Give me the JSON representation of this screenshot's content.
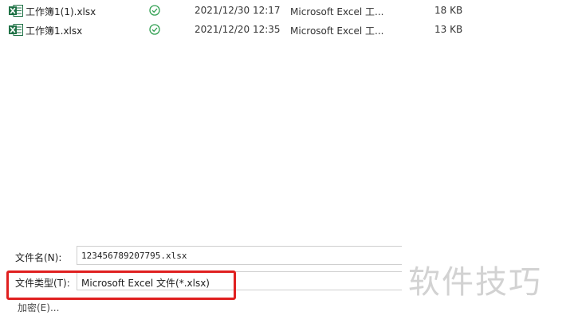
{
  "files": [
    {
      "name": "工作簿1(1).xlsx",
      "date": "2021/12/30 12:17",
      "type": "Microsoft Excel 工...",
      "size": "18 KB",
      "status_icon": "synced-check-icon"
    },
    {
      "name": "工作簿1.xlsx",
      "date": "2021/12/20 12:35",
      "type": "Microsoft Excel 工...",
      "size": "13 KB",
      "status_icon": "synced-check-icon"
    }
  ],
  "form": {
    "filename_label": "文件名(N):",
    "filename_value": "123456789207795.xlsx",
    "filetype_label": "文件类型(T):",
    "filetype_value": "Microsoft Excel 文件(*.xlsx)",
    "encrypt_link": "加密(E)..."
  },
  "watermark": "软件技巧",
  "colors": {
    "highlight": "#e02020",
    "excel_green": "#1e7145",
    "status_green": "#2e9e4f"
  }
}
